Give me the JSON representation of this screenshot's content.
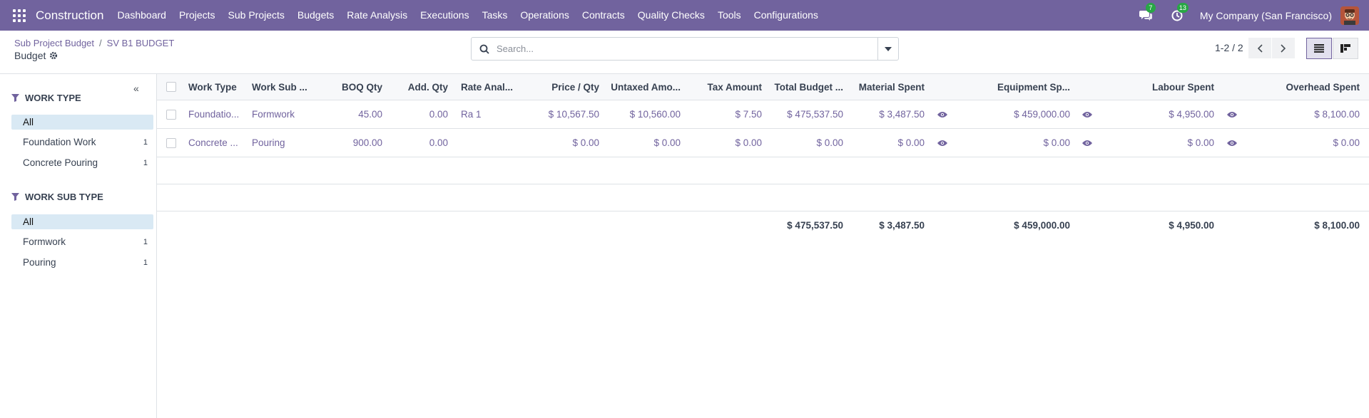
{
  "navbar": {
    "brand": "Construction",
    "menu": [
      "Dashboard",
      "Projects",
      "Sub Projects",
      "Budgets",
      "Rate Analysis",
      "Executions",
      "Tasks",
      "Operations",
      "Contracts",
      "Quality Checks",
      "Tools",
      "Configurations"
    ],
    "messages_badge": "7",
    "activities_badge": "13",
    "company": "My Company (San Francisco)",
    "accent_color": "#71639e",
    "badge_color": "#28a745"
  },
  "breadcrumb": {
    "parent": "Sub Project Budget",
    "separator": "/",
    "current": "SV B1 BUDGET"
  },
  "page_title": "Budget",
  "search": {
    "placeholder": "Search..."
  },
  "pager": {
    "text": "1-2 / 2"
  },
  "sidebar": {
    "groups": [
      {
        "title": "WORK TYPE",
        "items": [
          {
            "label": "All",
            "count": ""
          },
          {
            "label": "Foundation Work",
            "count": "1"
          },
          {
            "label": "Concrete Pouring",
            "count": "1"
          }
        ]
      },
      {
        "title": "WORK SUB TYPE",
        "items": [
          {
            "label": "All",
            "count": ""
          },
          {
            "label": "Formwork",
            "count": "1"
          },
          {
            "label": "Pouring",
            "count": "1"
          }
        ]
      }
    ]
  },
  "table": {
    "headers": {
      "work_type": "Work Type",
      "work_sub_type": "Work Sub ...",
      "boq_qty": "BOQ Qty",
      "add_qty": "Add. Qty",
      "rate_analysis": "Rate Anal...",
      "price_qty": "Price / Qty",
      "untaxed_amount": "Untaxed Amo...",
      "tax_amount": "Tax Amount",
      "total_budget": "Total Budget ...",
      "material_spent": "Material Spent",
      "equipment_spent": "Equipment Sp...",
      "labour_spent": "Labour Spent",
      "overhead_spent": "Overhead Spent"
    },
    "rows": [
      {
        "work_type": "Foundatio...",
        "work_sub_type": "Formwork",
        "boq_qty": "45.00",
        "add_qty": "0.00",
        "rate_analysis": "Ra 1",
        "price_qty": "$ 10,567.50",
        "untaxed_amount": "$ 10,560.00",
        "tax_amount": "$ 7.50",
        "total_budget": "$ 475,537.50",
        "material_spent": "$ 3,487.50",
        "equipment_spent": "$ 459,000.00",
        "labour_spent": "$ 4,950.00",
        "overhead_spent": "$ 8,100.00"
      },
      {
        "work_type": "Concrete ...",
        "work_sub_type": "Pouring",
        "boq_qty": "900.00",
        "add_qty": "0.00",
        "rate_analysis": "",
        "price_qty": "$ 0.00",
        "untaxed_amount": "$ 0.00",
        "tax_amount": "$ 0.00",
        "total_budget": "$ 0.00",
        "material_spent": "$ 0.00",
        "equipment_spent": "$ 0.00",
        "labour_spent": "$ 0.00",
        "overhead_spent": "$ 0.00"
      }
    ],
    "totals": {
      "total_budget": "$ 475,537.50",
      "material_spent": "$ 3,487.50",
      "equipment_spent": "$ 459,000.00",
      "labour_spent": "$ 4,950.00",
      "overhead_spent": "$ 8,100.00"
    }
  }
}
